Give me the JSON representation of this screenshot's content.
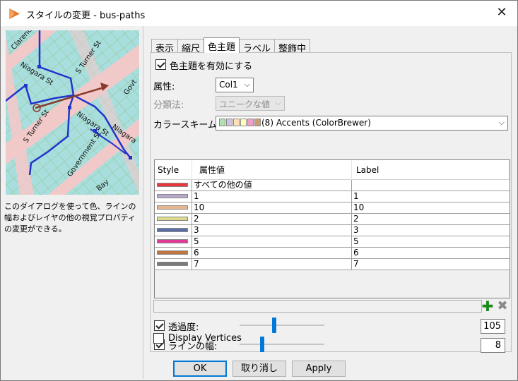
{
  "window": {
    "title": "スタイルの変更 - bus-paths",
    "close_glyph": "✕"
  },
  "preview": {
    "street_labels": [
      "Clarence",
      "Niagara St",
      "S Turner St",
      "Niagara St",
      "S Turner St",
      "Niagara",
      "Govt",
      "Government St",
      "Bay"
    ]
  },
  "description": "このダイアログを使って色、ラインの幅およびレイヤの他の視覚プロパティの変更ができる。",
  "tabs": [
    "表示",
    "縮尺",
    "色主題",
    "ラベル",
    "整飾中"
  ],
  "active_tab": "色主題",
  "theme": {
    "enable_label": "色主題を有効にする",
    "enable_checked": true,
    "attribute_label": "属性:",
    "attribute_value": "Col1",
    "classification_label": "分類法:",
    "classification_value": "ユニークな値",
    "scheme_label": "カラースキーム:",
    "scheme_value": "(8) Accents (ColorBrewer)",
    "scheme_swatches": [
      "#b3dfb3",
      "#cfc1e0",
      "#fde0b8",
      "#ffffb8",
      "#f0a0c8",
      "#c8a070"
    ]
  },
  "table": {
    "headers": [
      "Style",
      "属性値",
      "Label"
    ],
    "rows": [
      {
        "color": "#e8383c",
        "value": "すべての他の値",
        "label": ""
      },
      {
        "color": "#b8a8cc",
        "value": "1",
        "label": "1"
      },
      {
        "color": "#e8b48c",
        "value": "10",
        "label": "10"
      },
      {
        "color": "#dcdc8c",
        "value": "2",
        "label": "2"
      },
      {
        "color": "#5a6ea8",
        "value": "3",
        "label": "3"
      },
      {
        "color": "#e03c96",
        "value": "5",
        "label": "5"
      },
      {
        "color": "#c07440",
        "value": "6",
        "label": "6"
      },
      {
        "color": "#7a7a7a",
        "value": "7",
        "label": "7"
      }
    ]
  },
  "icons": {
    "add": "plus-icon",
    "remove": "x-icon"
  },
  "transparency": {
    "label": "透過度:",
    "checked": true,
    "value": "105",
    "level": 0.41
  },
  "line_width": {
    "label": "ラインの幅:",
    "checked": true,
    "value": "8",
    "level": 0.27
  },
  "vertices": {
    "label": "Display Vertices",
    "checked": false
  },
  "buttons": {
    "ok": "OK",
    "cancel": "取り消し",
    "apply": "Apply"
  }
}
